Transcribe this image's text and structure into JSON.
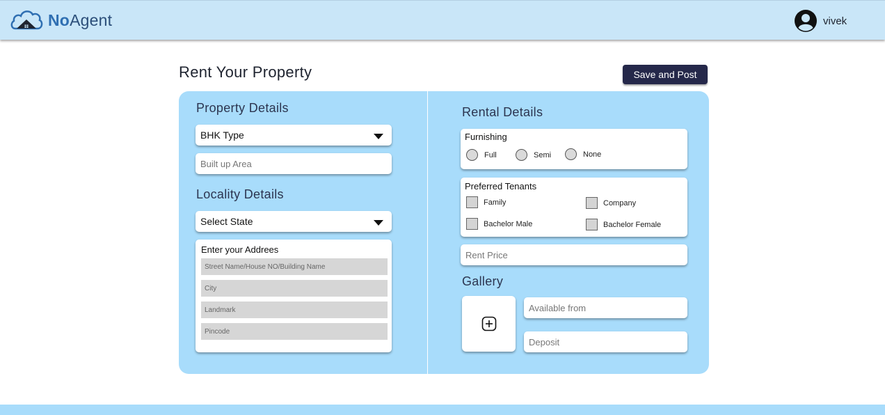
{
  "header": {
    "brand_part1": "No",
    "brand_part2": "Agent",
    "username": "vivek"
  },
  "page": {
    "title": "Rent Your Property",
    "save_label": "Save and Post"
  },
  "property": {
    "title": "Property Details",
    "bhk_label": "BHK Type",
    "area_placeholder": "Built up Area"
  },
  "locality": {
    "title": "Locality Details",
    "state_label": "Select State",
    "address_title": "Enter your Addrees",
    "street_placeholder": "Street Name/House NO/Building Name",
    "city_placeholder": "City",
    "landmark_placeholder": "Landmark",
    "pincode_placeholder": "Pincode"
  },
  "rental": {
    "title": "Rental Details",
    "furnishing_title": "Furnishing",
    "furnishing_options": [
      "Full",
      "Semi",
      "None"
    ],
    "tenants_title": "Preferred Tenants",
    "tenant_options": [
      "Family",
      "Company",
      "Bachelor Male",
      "Bachelor Female"
    ],
    "rent_placeholder": "Rent Price"
  },
  "gallery": {
    "title": "Gallery",
    "available_placeholder": "Available from",
    "deposit_placeholder": "Deposit"
  },
  "colors": {
    "topbar": "#c9e6f8",
    "card": "#a8dcfb",
    "button": "#25284a",
    "brand_accent": "#2f6fb2"
  }
}
